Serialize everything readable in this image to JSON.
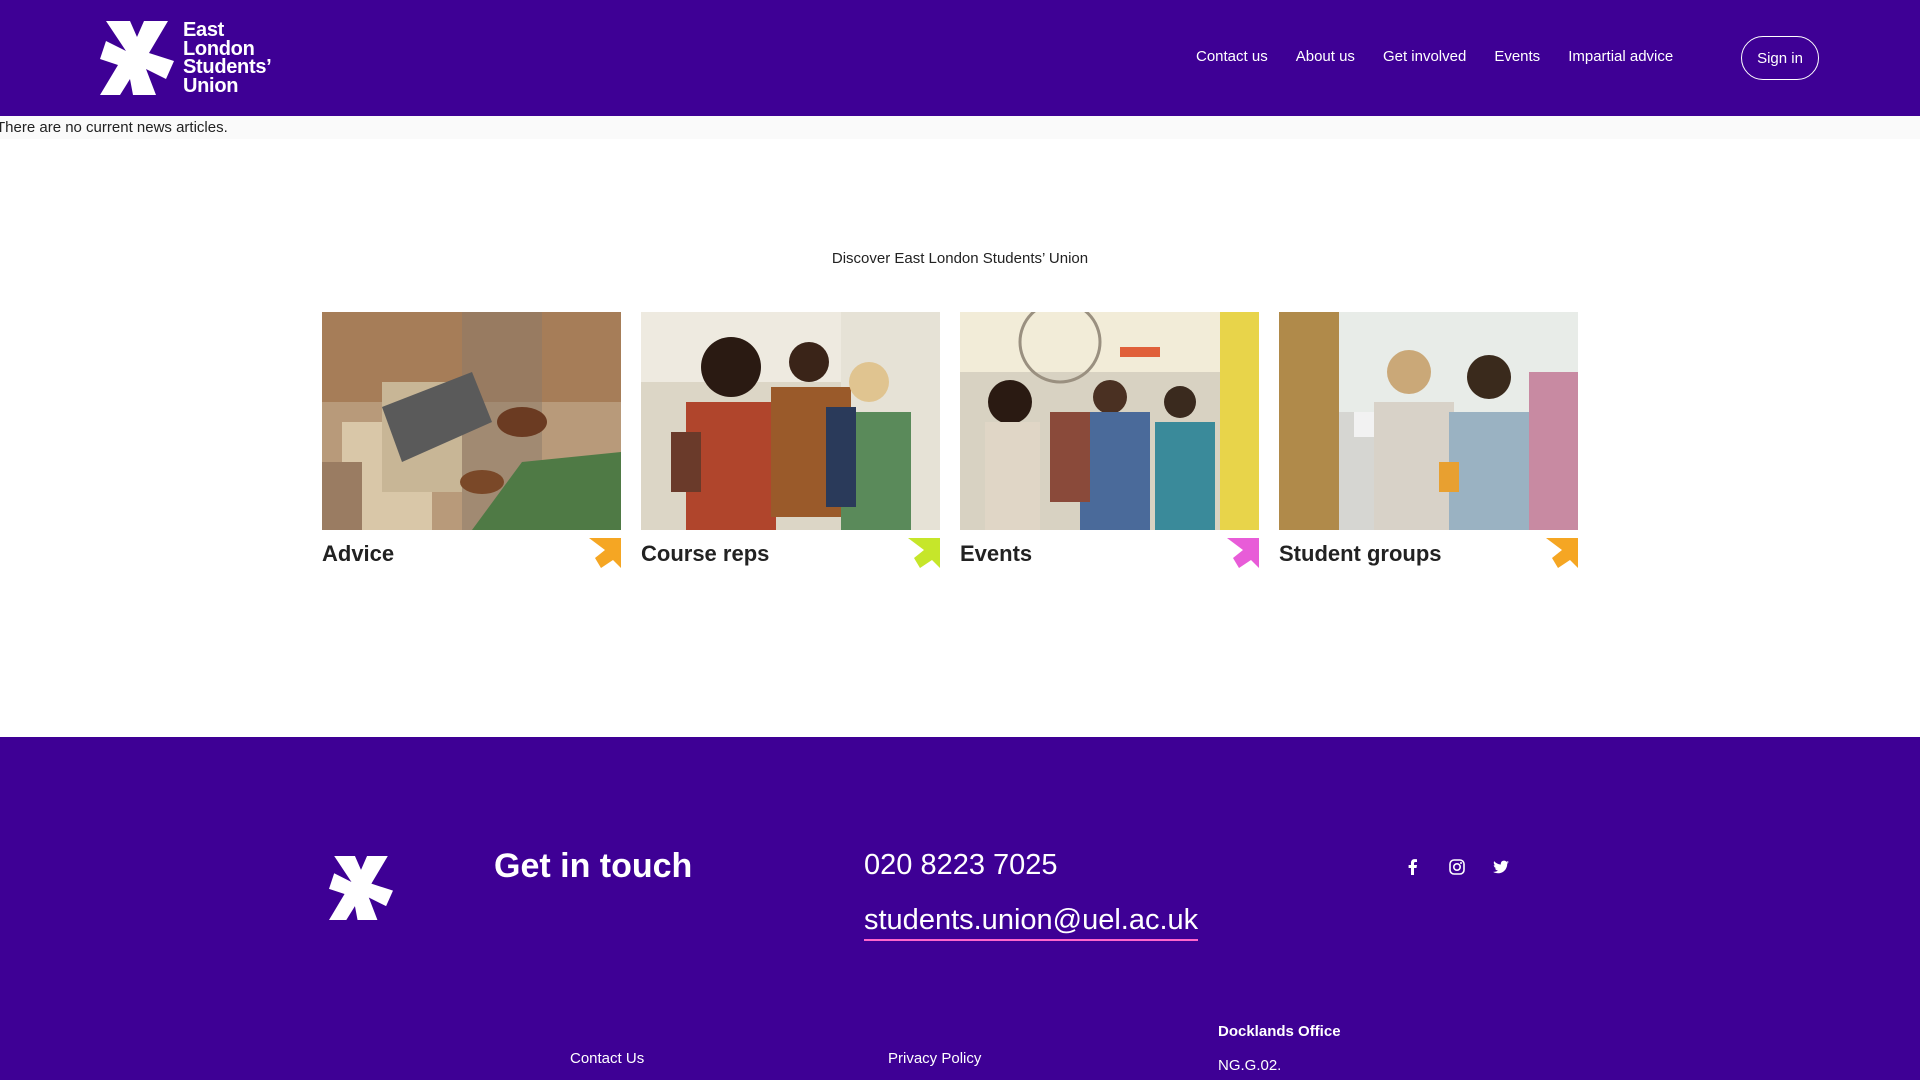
{
  "header": {
    "logo_lines": [
      "East",
      "London",
      "Students’",
      "Union"
    ],
    "nav": [
      "Contact us",
      "About us",
      "Get involved",
      "Events",
      "Impartial advice"
    ],
    "sign_in": "Sign in"
  },
  "notice": "There are no current news articles.",
  "discover": {
    "title": "Discover East London Students’ Union",
    "cards": [
      {
        "label": "Advice",
        "arrow_color": "#f5a623",
        "image": "advice-photo"
      },
      {
        "label": "Course reps",
        "arrow_color": "#c6e62a",
        "image": "course-reps-photo"
      },
      {
        "label": "Events",
        "arrow_color": "#e85cd8",
        "image": "events-photo"
      },
      {
        "label": "Student groups",
        "arrow_color": "#f5a623",
        "image": "student-groups-photo"
      }
    ]
  },
  "footer": {
    "heading": "Get in touch",
    "phone": "020 8223 7025",
    "email": "students.union@uel.ac.uk",
    "social": [
      "facebook-icon",
      "instagram-icon",
      "twitter-icon"
    ],
    "links": [
      "Contact Us",
      "Privacy Policy"
    ],
    "office": {
      "title": "Docklands Office",
      "line1": "NG.G.02."
    }
  },
  "colors": {
    "brand_purple": "#3e0095",
    "email_underline": "#ff66cc"
  }
}
